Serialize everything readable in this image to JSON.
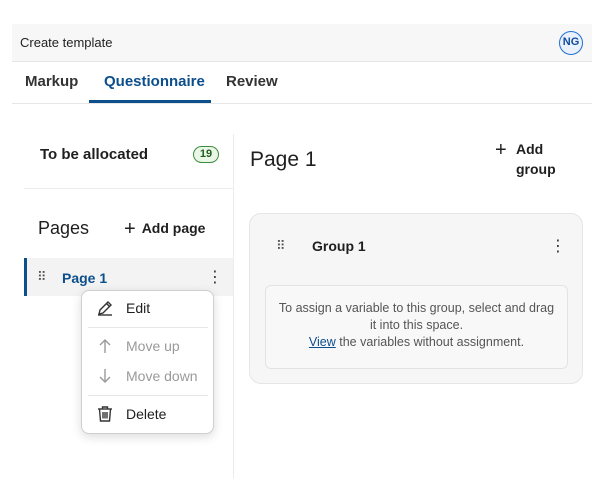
{
  "header": {
    "title": "Create template",
    "avatar_initials": "NG"
  },
  "tabs": [
    {
      "label": "Markup",
      "active": false
    },
    {
      "label": "Questionnaire",
      "active": true
    },
    {
      "label": "Review",
      "active": false
    }
  ],
  "left_panel": {
    "to_be_allocated_label": "To be allocated",
    "to_be_allocated_count": "19",
    "pages_title": "Pages",
    "add_page_label": "Add page",
    "pages": [
      {
        "label": "Page 1",
        "selected": true
      }
    ]
  },
  "context_menu": {
    "items": [
      {
        "label": "Edit",
        "icon": "pencil-icon",
        "disabled": false
      },
      {
        "label": "Move up",
        "icon": "arrow-up-icon",
        "disabled": true
      },
      {
        "label": "Move down",
        "icon": "arrow-down-icon",
        "disabled": true
      },
      {
        "label": "Delete",
        "icon": "trash-icon",
        "disabled": false
      }
    ]
  },
  "main": {
    "page_title": "Page 1",
    "add_group_line1": "Add",
    "add_group_line2": "group",
    "group": {
      "name": "Group 1",
      "drop_hint": "To assign a variable to this group, select and drag it into this space.",
      "view_link": "View",
      "view_suffix": " the variables without assignment."
    }
  },
  "colors": {
    "accent": "#0c4f8c",
    "badge_border": "#3d8c3d",
    "badge_bg": "#eaf6e6"
  }
}
